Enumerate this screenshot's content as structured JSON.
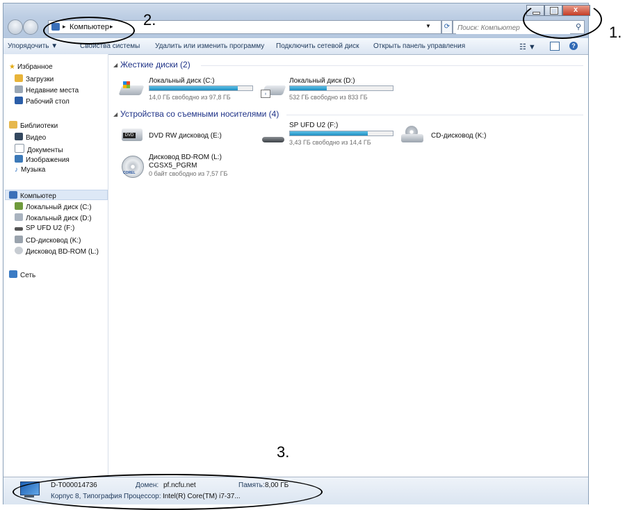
{
  "address": {
    "crumb": "Компьютер",
    "search_placeholder": "Поиск: Компьютер"
  },
  "toolbar": {
    "organize": "Упорядочить",
    "system_props": "Свойства системы",
    "uninstall": "Удалить или изменить программу",
    "map_drive": "Подключить сетевой диск",
    "control_panel": "Открыть панель управления"
  },
  "sidebar": {
    "favorites": "Избранное",
    "downloads": "Загрузки",
    "recent": "Недавние места",
    "desktop": "Рабочий стол",
    "libraries": "Библиотеки",
    "video": "Видео",
    "documents": "Документы",
    "images": "Изображения",
    "music": "Музыка",
    "computer": "Компьютер",
    "disk_c": "Локальный диск (C:)",
    "disk_d": "Локальный диск (D:)",
    "disk_f": "SP UFD U2 (F:)",
    "disk_k": "CD-дисковод (K:)",
    "disk_l": "Дисковод BD-ROM (L:)",
    "network": "Сеть"
  },
  "content": {
    "hdd_group": "Жесткие диски (2)",
    "removable_group": "Устройства со съемными носителями (4)",
    "drive_c": {
      "name": "Локальный диск (C:)",
      "free": "14,0 ГБ свободно из 97,8 ГБ",
      "used": 0.86
    },
    "drive_d": {
      "name": "Локальный диск (D:)",
      "free": "532 ГБ свободно из 833 ГБ",
      "used": 0.36
    },
    "drive_e": {
      "name": "DVD RW дисковод (E:)"
    },
    "drive_f": {
      "name": "SP UFD U2 (F:)",
      "free": "3,43 ГБ свободно из 14,4 ГБ",
      "used": 0.76
    },
    "drive_k": {
      "name": "CD-дисковод (K:)"
    },
    "drive_l": {
      "name": "Дисковод BD-ROM (L:)",
      "label": "CGSX5_PGRM",
      "free": "0 байт свободно из 7,57 ГБ"
    }
  },
  "details": {
    "computer_name": "D-T000014736",
    "workgroup": "Корпус 8, Типография",
    "domain_label": "Домен:",
    "domain": "pf.ncfu.net",
    "memory_label": "Память:",
    "memory": "8,00 ГБ",
    "cpu_label": "Процессор:",
    "cpu": "Intel(R) Core(TM) i7-37..."
  },
  "annotations": {
    "n1": "1.",
    "n2": "2.",
    "n3": "3."
  }
}
